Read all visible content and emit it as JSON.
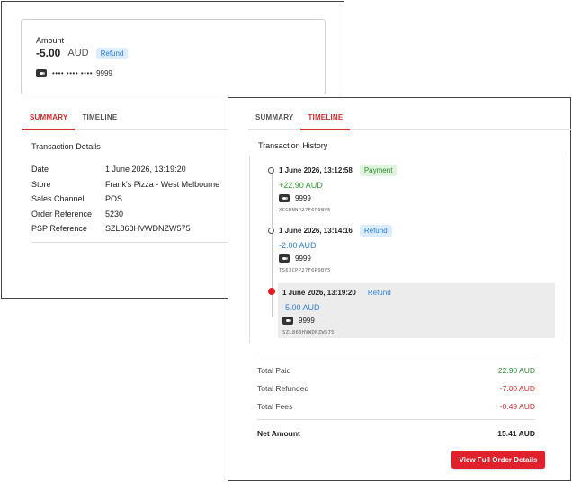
{
  "summary_panel": {
    "amount_label": "Amount",
    "amount_value": "-5.00",
    "currency": "AUD",
    "status_badge": "Refund",
    "card_mask": "•••• •••• ••••",
    "card_last4": "9999",
    "tabs": [
      {
        "label": "SUMMARY",
        "active": true
      },
      {
        "label": "TIMELINE",
        "active": false
      }
    ],
    "section_title": "Transaction Details",
    "details": [
      {
        "key": "Date",
        "value": "1 June 2026, 13:19:20"
      },
      {
        "key": "Store",
        "value": "Frank's Pizza - West Melbourne"
      },
      {
        "key": "Sales Channel",
        "value": "POS"
      },
      {
        "key": "Order Reference",
        "value": "5230"
      },
      {
        "key": "PSP Reference",
        "value": "SZL868HVWDNZW575"
      }
    ]
  },
  "timeline_panel": {
    "tabs": [
      {
        "label": "SUMMARY",
        "active": false
      },
      {
        "label": "TIMELINE",
        "active": true
      }
    ],
    "section_title": "Transaction History",
    "entries": [
      {
        "time": "1 June 2026, 13:12:58",
        "badge": "Payment",
        "amount": "+22.90 AUD",
        "card_last4": "9999",
        "reference": "XCGDNNP27F6R9BV5"
      },
      {
        "time": "1 June 2026, 13:14:16",
        "badge": "Refund",
        "amount": "-2.00 AUD",
        "card_last4": "9999",
        "reference": "TS63CPP27F6R9BV5"
      },
      {
        "time": "1 June 2026, 13:19:20",
        "badge": "Refund",
        "amount": "-5.00 AUD",
        "card_last4": "9999",
        "reference": "SZL868HVWDNZW575"
      }
    ],
    "totals": {
      "paid_label": "Total Paid",
      "paid_value": "22.90 AUD",
      "refunded_label": "Total Refunded",
      "refunded_value": "-7.00 AUD",
      "fees_label": "Total Fees",
      "fees_value": "-0.49 AUD",
      "net_label": "Net Amount",
      "net_value": "15.41 AUD"
    },
    "view_button_label": "View Full Order Details"
  },
  "colors": {
    "accent_red": "#e0212b",
    "positive_green": "#2e9e2e",
    "refund_blue": "#2b7fd6"
  }
}
